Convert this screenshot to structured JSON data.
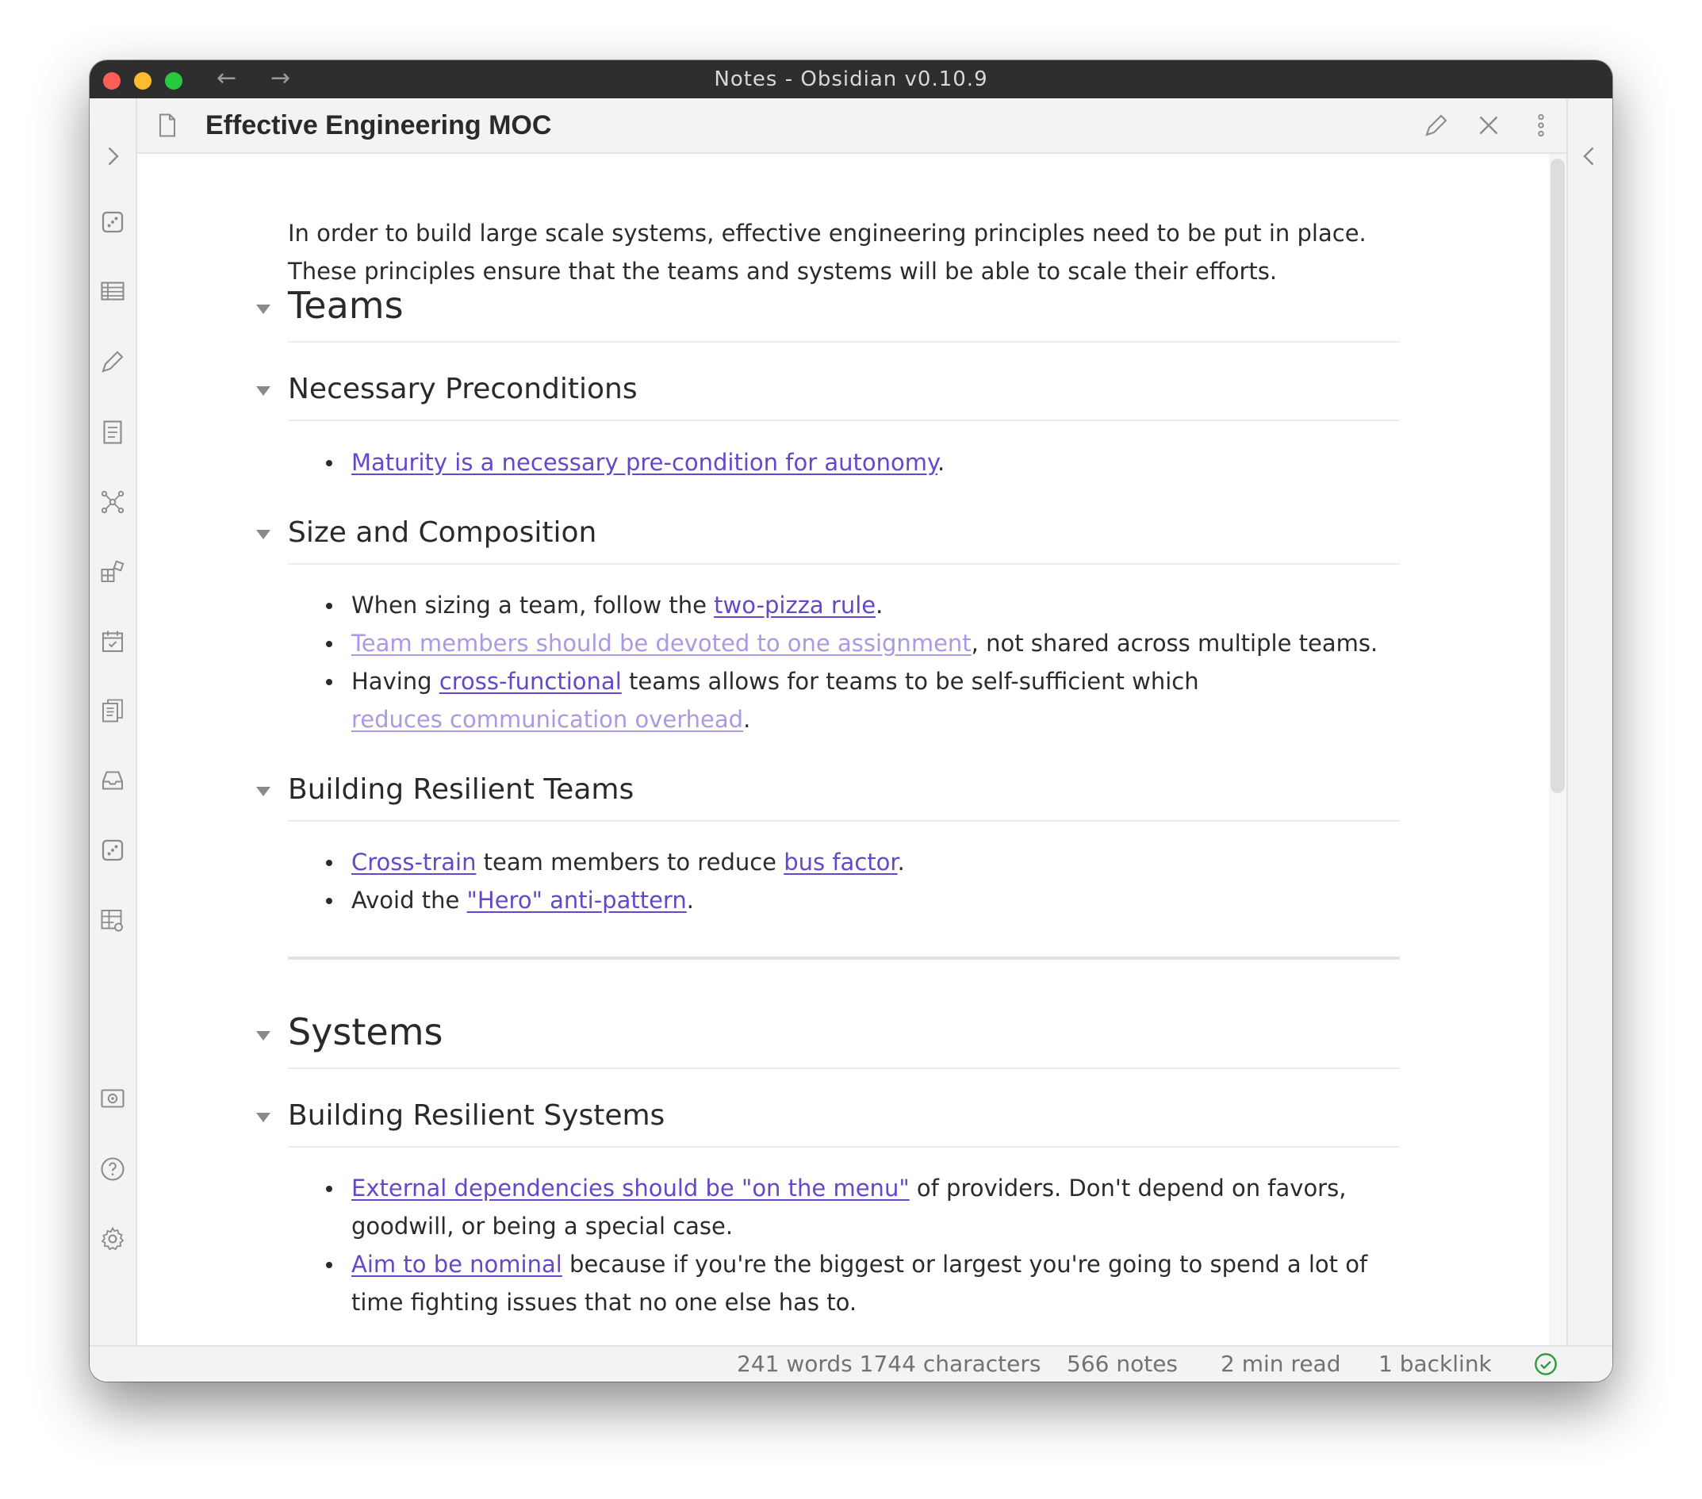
{
  "window": {
    "title": "Notes - Obsidian v0.10.9",
    "nav_back": "←",
    "nav_forward": "→"
  },
  "ribbon": {
    "items": [
      {
        "icon": "chevron-right-icon",
        "label": "Expand sidebar"
      },
      {
        "icon": "dice-icon",
        "label": "Random note"
      },
      {
        "icon": "table-icon",
        "label": "Table"
      },
      {
        "icon": "pencil-icon",
        "label": "Edit"
      },
      {
        "icon": "document-list-icon",
        "label": "Outline"
      },
      {
        "icon": "graph-icon",
        "label": "Graph view"
      },
      {
        "icon": "blocks-icon",
        "label": "Plugins"
      },
      {
        "icon": "calendar-check-icon",
        "label": "Daily note"
      },
      {
        "icon": "documents-icon",
        "label": "Templates"
      },
      {
        "icon": "archive-icon",
        "label": "Archive"
      },
      {
        "icon": "dice-icon",
        "label": "Random note 2"
      },
      {
        "icon": "table-settings-icon",
        "label": "Table settings"
      },
      {
        "icon": "vault-icon",
        "label": "Open vault"
      },
      {
        "icon": "help-icon",
        "label": "Help"
      },
      {
        "icon": "gear-icon",
        "label": "Settings"
      }
    ]
  },
  "pane": {
    "title": "Effective Engineering MOC",
    "actions": [
      "pencil-icon",
      "close-icon",
      "more-vertical-icon"
    ]
  },
  "document": {
    "intro_line1": "In order to build large scale systems, effective engineering principles need to be put in place.",
    "intro_line2": "These principles ensure that the teams and systems will be able to scale their efforts.",
    "h_teams": "Teams",
    "h_preconditions": "Necessary Preconditions",
    "pre_link": "Maturity is a necessary pre-condition for autonomy",
    "pre_after": ".",
    "h_size": "Size and Composition",
    "size_1_before": "When sizing a team, follow the ",
    "size_1_link": "two-pizza rule",
    "size_1_after": ".",
    "size_2_link": "Team members should be devoted to one assignment",
    "size_2_after": ", not shared across multiple teams.",
    "size_3_before": "Having ",
    "size_3_link1": "cross-functional",
    "size_3_mid": " teams allows for teams to be self-sufficient which ",
    "size_3_link2": "reduces communication overhead",
    "size_3_after": ".",
    "h_resilient_teams": "Building Resilient Teams",
    "rt_1_link1": "Cross-train",
    "rt_1_mid": " team members to reduce ",
    "rt_1_link2": "bus factor",
    "rt_1_after": ".",
    "rt_2_before": "Avoid the ",
    "rt_2_link": "\"Hero\" anti-pattern",
    "rt_2_after": ".",
    "h_systems": "Systems",
    "h_resilient_systems": "Building Resilient Systems",
    "rs_1_link": "External dependencies should be \"on the menu\"",
    "rs_1_after": " of providers. Don't depend on favors, goodwill, or being a special case.",
    "rs_2_link": "Aim to be nominal",
    "rs_2_after": " because if you're the biggest or largest you're going to spend a lot of time fighting issues that no one else has to."
  },
  "status": {
    "words": "241 words 1744 characters",
    "notes": "566 notes",
    "read": "2 min read",
    "backlinks": "1 backlink",
    "sync_icon": "check-circle-icon"
  },
  "colors": {
    "link": "#6548c9",
    "unresolved_link": "#ad98e2",
    "sync_ok": "#2f9a3c"
  }
}
